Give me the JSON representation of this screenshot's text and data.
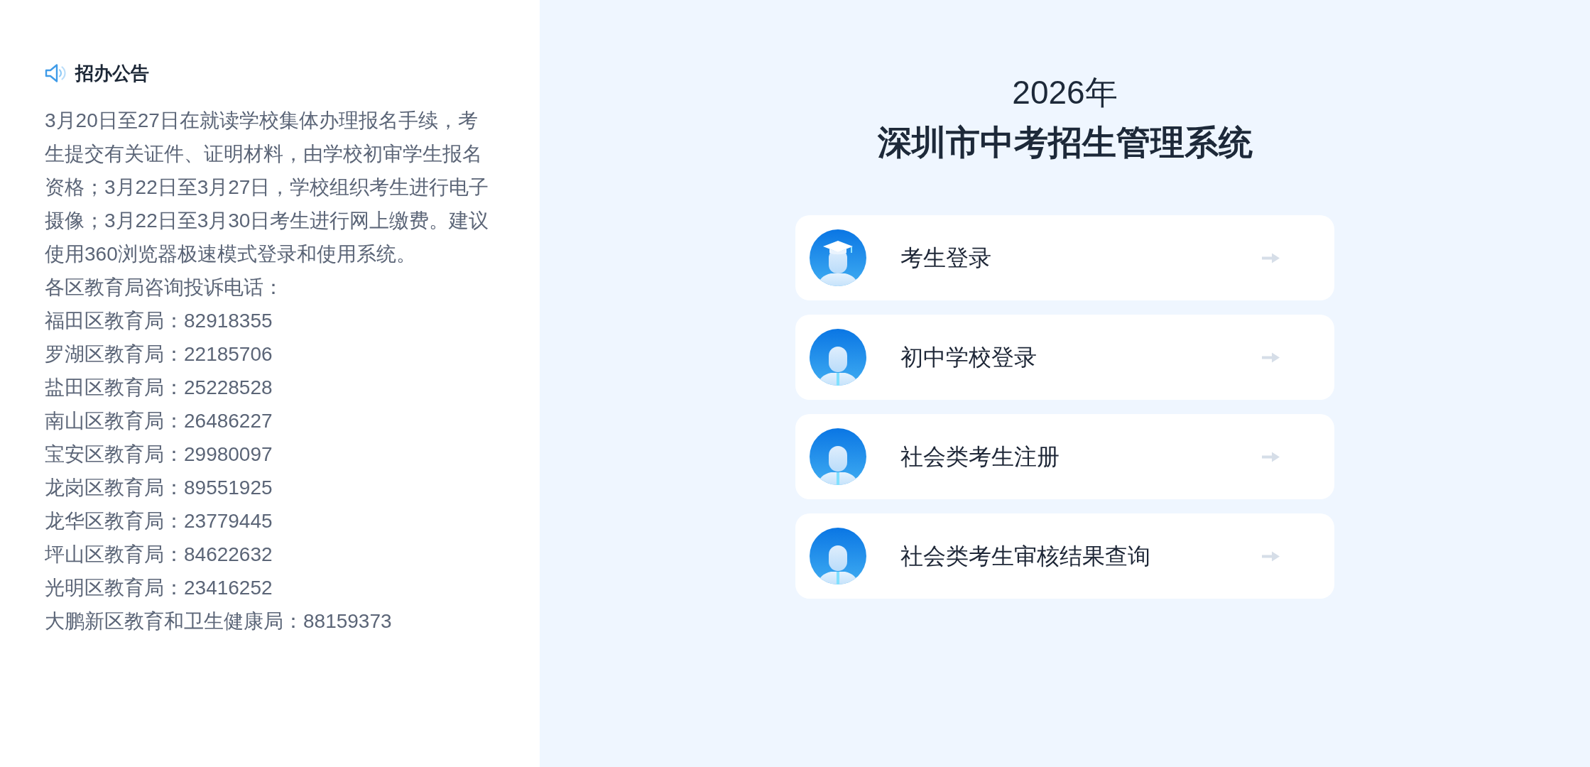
{
  "notice": {
    "title": "招办公告",
    "body": "3月20日至27日在就读学校集体办理报名手续，考生提交有关证件、证明材料，由学校初审学生报名资格；3月22日至3月27日，学校组织考生进行电子摄像；3月22日至3月30日考生进行网上缴费。建议使用360浏览器极速模式登录和使用系统。",
    "hotline_heading": "各区教育局咨询投诉电话：",
    "hotlines": [
      "福田区教育局：82918355",
      "罗湖区教育局：22185706",
      "盐田区教育局：25228528",
      "南山区教育局：26486227",
      "宝安区教育局：29980097",
      "龙岗区教育局：89551925",
      "龙华区教育局：23779445",
      "坪山区教育局：84622632",
      "光明区教育局：23416252",
      "大鹏新区教育和卫生健康局：88159373"
    ]
  },
  "header": {
    "year": "2026年",
    "title": "深圳市中考招生管理系统"
  },
  "entries": [
    {
      "kind": "graduate",
      "label": "考生登录"
    },
    {
      "kind": "staff",
      "label": "初中学校登录"
    },
    {
      "kind": "staff",
      "label": "社会类考生注册"
    },
    {
      "kind": "staff",
      "label": "社会类考生审核结果查询"
    }
  ]
}
